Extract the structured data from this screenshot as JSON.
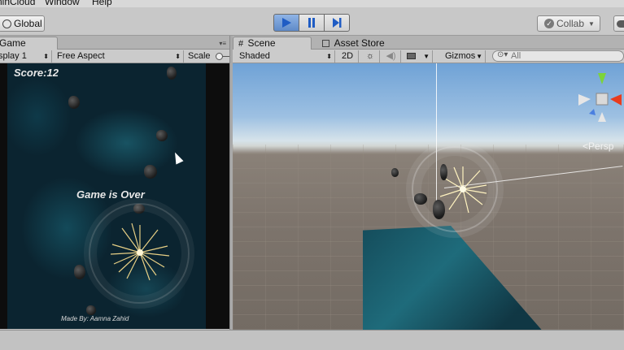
{
  "menu": {
    "items": [
      "ninCloud",
      "Window",
      "Help"
    ]
  },
  "toolbar": {
    "global_label": "Global",
    "collab_label": "Collab",
    "play_icons": [
      "play-icon",
      "pause-icon",
      "step-icon"
    ]
  },
  "game_panel": {
    "tab_label": "Game",
    "display_label": "splay 1",
    "aspect_label": "Free Aspect",
    "scale_label": "Scale",
    "score_text": "Score:12",
    "game_over_text": "Game is Over",
    "made_by_text": "Made By: Aamna Zahid"
  },
  "scene_panel": {
    "tabs": [
      {
        "label": "Scene",
        "icon": "grid-icon"
      },
      {
        "label": "Asset Store",
        "icon": "store-icon"
      }
    ],
    "shading_label": "Shaded",
    "mode_2d_label": "2D",
    "gizmos_label": "Gizmos",
    "search_placeholder": "All",
    "persp_label": "Persp"
  },
  "colors": {
    "play_accent": "#1f5cc4",
    "game_background": "#0b2430",
    "sky": "#9dc0e2",
    "ground": "#7d746c"
  }
}
